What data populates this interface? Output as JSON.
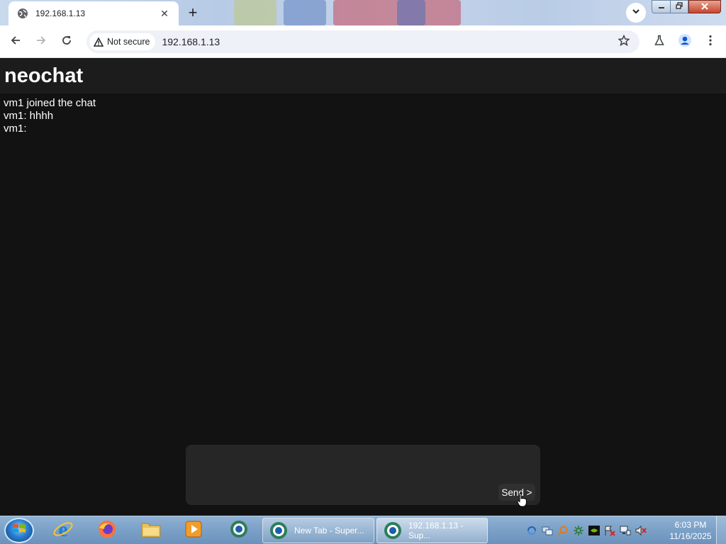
{
  "browser": {
    "tab_title": "192.168.1.13",
    "new_tab_symbol": "+",
    "close_tab_symbol": "✕",
    "security_label": "Not secure",
    "url": "192.168.1.13"
  },
  "app": {
    "title": "neochat",
    "messages": [
      "vm1 joined the chat",
      "vm1: hhhh",
      "vm1:"
    ],
    "input_value": "",
    "send_label": "Send >"
  },
  "taskbar": {
    "tasks": [
      {
        "label": "New Tab - Super...",
        "active": false
      },
      {
        "label": "192.168.1.13 - Sup...",
        "active": true
      }
    ],
    "time": "6:03 PM",
    "date": "11/16/2025"
  },
  "icons": {
    "tab_favicon": "globe-icon",
    "back": "back-arrow-icon",
    "forward": "forward-arrow-icon",
    "reload": "reload-icon",
    "warning": "warning-icon",
    "bookmark": "star-icon",
    "labs": "flask-icon",
    "profile": "profile-icon",
    "menu": "kebab-menu-icon"
  },
  "colors": {
    "page_bg": "#121212",
    "header_bg": "#1c1c1c",
    "composer_bg": "#262626",
    "send_bg": "#303030",
    "text": "#ffffff"
  }
}
